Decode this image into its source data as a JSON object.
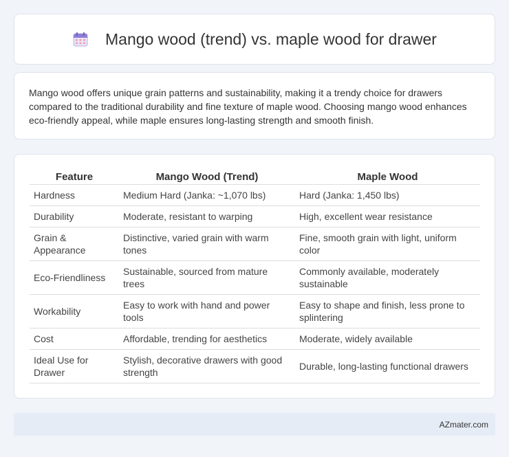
{
  "header": {
    "title": "Mango wood (trend) vs. maple wood for drawer",
    "icon": "calendar-icon"
  },
  "description": "Mango wood offers unique grain patterns and sustainability, making it a trendy choice for drawers compared to the traditional durability and fine texture of maple wood. Choosing mango wood enhances eco-friendly appeal, while maple ensures long-lasting strength and smooth finish.",
  "table": {
    "headers": [
      "Feature",
      "Mango Wood (Trend)",
      "Maple Wood"
    ],
    "rows": [
      [
        "Hardness",
        "Medium Hard (Janka: ~1,070 lbs)",
        "Hard (Janka: 1,450 lbs)"
      ],
      [
        "Durability",
        "Moderate, resistant to warping",
        "High, excellent wear resistance"
      ],
      [
        "Grain & Appearance",
        "Distinctive, varied grain with warm tones",
        "Fine, smooth grain with light, uniform color"
      ],
      [
        "Eco-Friendliness",
        "Sustainable, sourced from mature trees",
        "Commonly available, moderately sustainable"
      ],
      [
        "Workability",
        "Easy to work with hand and power tools",
        "Easy to shape and finish, less prone to splintering"
      ],
      [
        "Cost",
        "Affordable, trending for aesthetics",
        "Moderate, widely available"
      ],
      [
        "Ideal Use for Drawer",
        "Stylish, decorative drawers with good strength",
        "Durable, long-lasting functional drawers"
      ]
    ]
  },
  "footer": {
    "brand": "AZmater.com"
  }
}
